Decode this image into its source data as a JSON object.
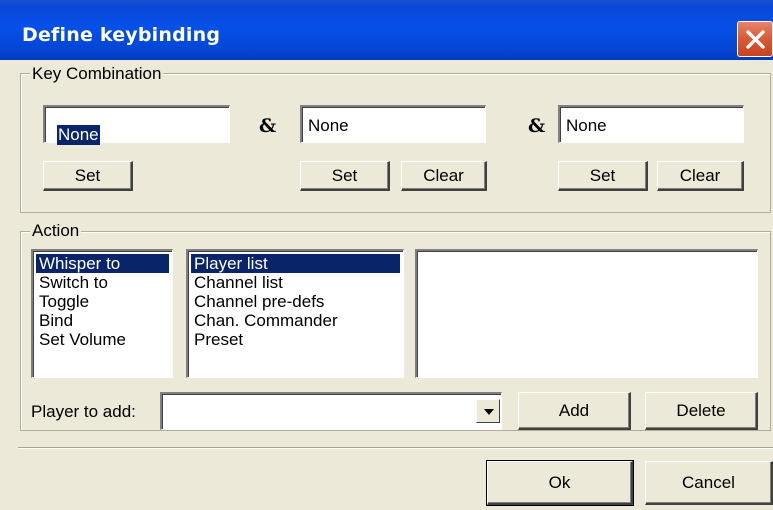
{
  "window": {
    "title": "Define keybinding"
  },
  "key_combination": {
    "label": "Key Combination",
    "ampersand": "&",
    "fields": [
      {
        "value": "None",
        "selected": true
      },
      {
        "value": "None"
      },
      {
        "value": "None"
      }
    ],
    "buttons": {
      "set": "Set",
      "clear": "Clear"
    }
  },
  "action": {
    "label": "Action",
    "actions": [
      "Whisper to",
      "Switch to",
      "Toggle",
      "Bind",
      "Set Volume"
    ],
    "targets": [
      "Player list",
      "Channel list",
      "Channel pre-defs",
      "Chan. Commander",
      "Preset"
    ],
    "player_to_add_label": "Player to add:",
    "player_to_add_value": "",
    "add_label": "Add",
    "delete_label": "Delete"
  },
  "footer": {
    "ok_label": "Ok",
    "cancel_label": "Cancel"
  },
  "colors": {
    "titlebar": "#0650e8",
    "selection": "#0a246a",
    "face": "#ece9d8",
    "close": "#d85a36"
  },
  "icons": {
    "close": "close-icon",
    "dropdown": "chevron-down-icon"
  }
}
